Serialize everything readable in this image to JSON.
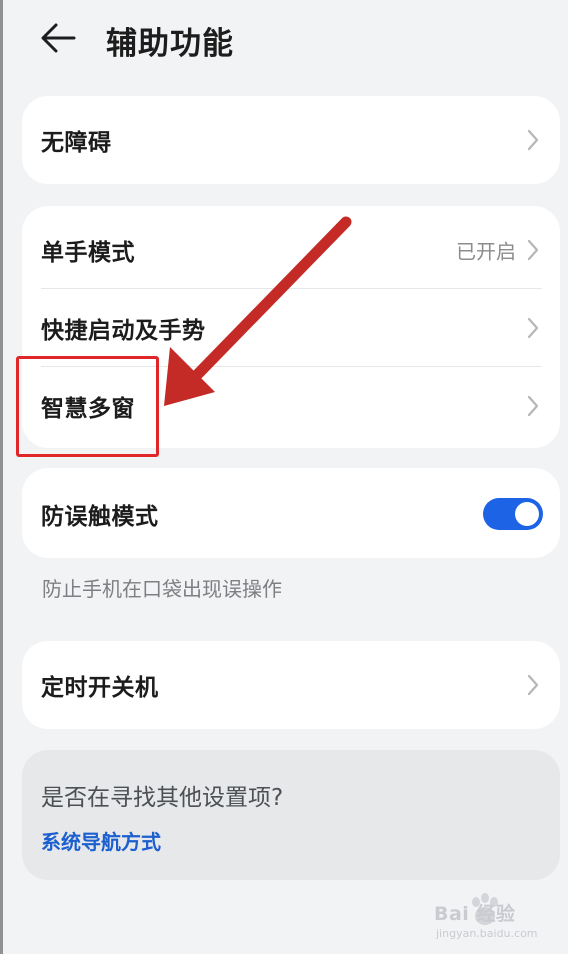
{
  "header": {
    "title": "辅助功能",
    "back_icon": "back-arrow-icon"
  },
  "group_accessibility": {
    "items": [
      {
        "label": "无障碍"
      }
    ]
  },
  "group_modes": {
    "items": [
      {
        "label": "单手模式",
        "value": "已开启"
      },
      {
        "label": "快捷启动及手势"
      },
      {
        "label": "智慧多窗"
      }
    ]
  },
  "group_touch": {
    "label": "防误触模式",
    "toggle_on": true,
    "hint": "防止手机在口袋出现误操作"
  },
  "group_timer": {
    "items": [
      {
        "label": "定时开关机"
      }
    ]
  },
  "search_suggest": {
    "question": "是否在寻找其他设置项?",
    "link": "系统导航方式"
  },
  "annotation": {
    "color": "#e1262a",
    "arrow_color": "#c42a26",
    "target": "智慧多窗"
  },
  "watermark": {
    "logo_text": "Bai  经验",
    "url": "jingyan.baidu.com"
  },
  "colors": {
    "accent": "#1c63e5",
    "link": "#1c5fcf",
    "background": "#f1f3f5"
  }
}
